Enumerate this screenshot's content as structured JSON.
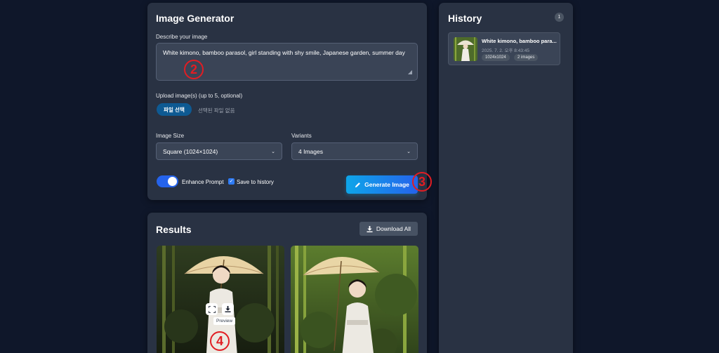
{
  "generator": {
    "title": "Image Generator",
    "describe_label": "Describe your image",
    "prompt_value": "White kimono, bamboo parasol, girl standing with shy smile, Japanese garden, summer day",
    "upload_label": "Upload image(s) (up to 5, optional)",
    "file_button": "파일 선택",
    "file_none": "선택된 파일 없음",
    "size_label": "Image Size",
    "size_value": "Square (1024×1024)",
    "variants_label": "Variants",
    "variants_value": "4 Images",
    "enhance_label": "Enhance Prompt",
    "enhance_on": true,
    "save_label": "Save to history",
    "save_checked": true,
    "generate_button": "Generate Image"
  },
  "results": {
    "title": "Results",
    "download_all": "Download All",
    "tooltip": "Preview"
  },
  "history": {
    "title": "History",
    "count": "1",
    "items": [
      {
        "title": "White kimono, bamboo para...",
        "date": "2025. 7. 2. 오후 8:43:45",
        "size": "1024x1024",
        "images": "2 images"
      }
    ]
  },
  "markers": [
    "2",
    "3",
    "4"
  ],
  "colors": {
    "background": "#0f172a",
    "panel": "#293243",
    "accent": "#2563eb",
    "marker": "#e11d23"
  },
  "icons": [
    "pencil-icon",
    "download-icon",
    "expand-icon",
    "chevron-down-icon",
    "check-icon"
  ]
}
